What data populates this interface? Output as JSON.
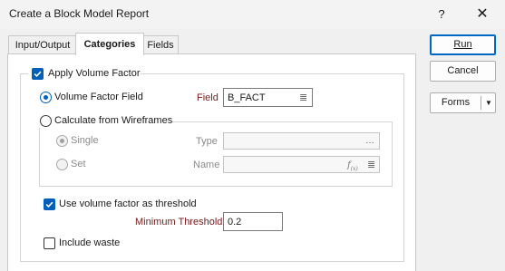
{
  "window": {
    "title": "Create a Block Model Report",
    "help": "?",
    "close": "✕"
  },
  "tabs": [
    "Input/Output",
    "Categories",
    "Fields"
  ],
  "active_tab": "Categories",
  "buttons": {
    "run": "Run",
    "cancel": "Cancel",
    "forms": "Forms"
  },
  "apply_volume_factor": {
    "label": "Apply Volume Factor",
    "checked": true
  },
  "volume_factor_field": {
    "label": "Volume Factor Field",
    "selected": true,
    "field_label": "Field",
    "field_value": "B_FACT"
  },
  "calc_wireframes": {
    "label": "Calculate from Wireframes",
    "selected": false,
    "single_label": "Single",
    "set_label": "Set",
    "type_label": "Type",
    "name_label": "Name",
    "type_value": "",
    "name_value": ""
  },
  "threshold": {
    "label": "Use volume factor as threshold",
    "checked": true,
    "min_label": "Minimum Threshold",
    "min_value": "0.2"
  },
  "include_waste": {
    "label": "Include waste",
    "checked": false
  },
  "icons": {
    "list": "list-icon",
    "browse": "browse-icon",
    "function": "function-icon",
    "dropdown": "chevron-down-icon"
  }
}
